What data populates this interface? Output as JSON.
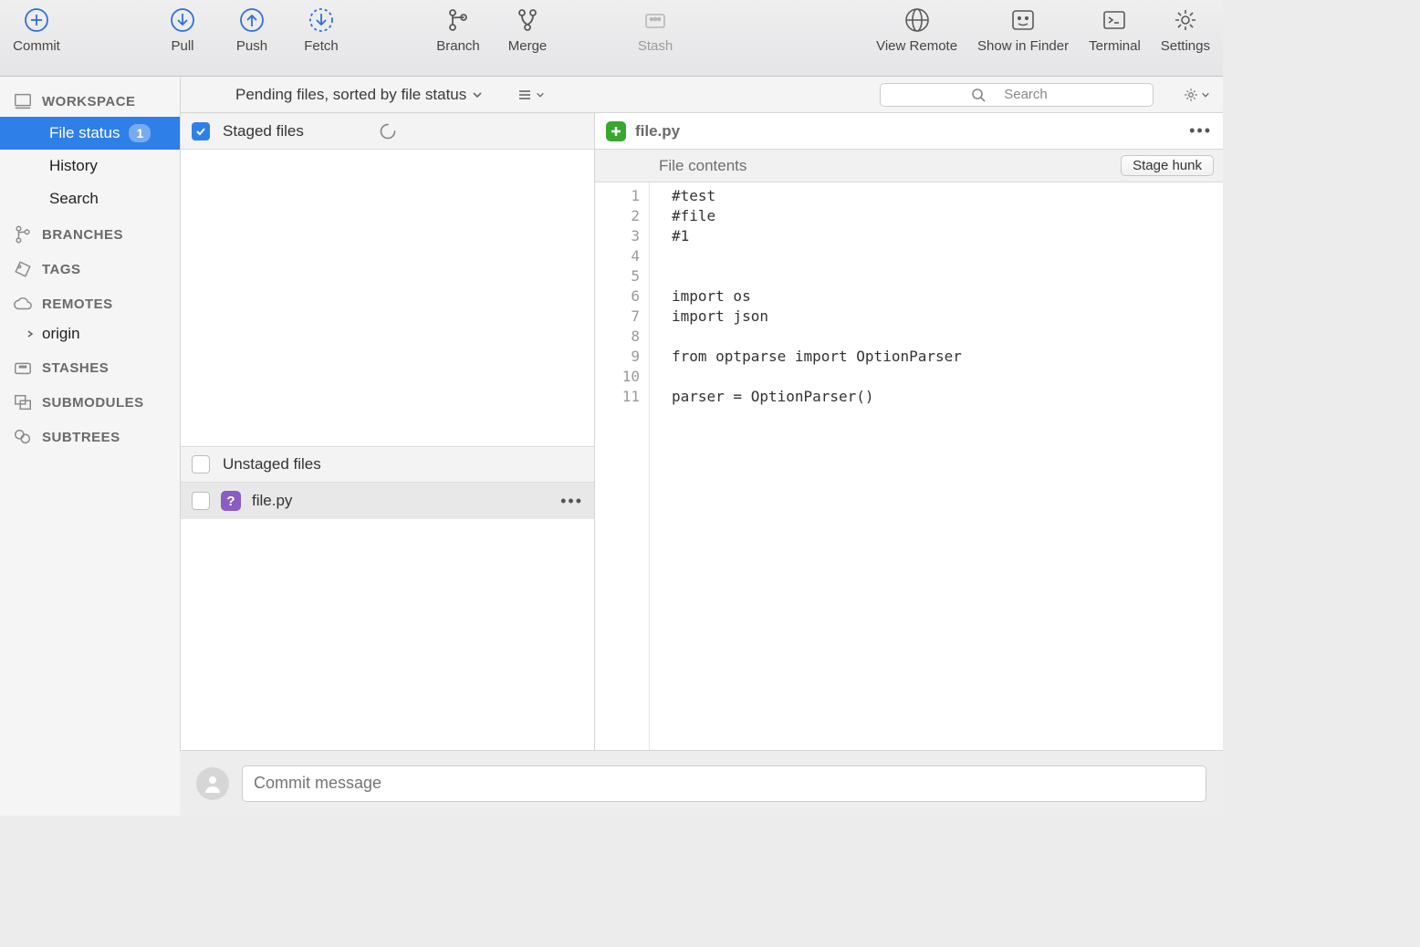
{
  "toolbar": {
    "commit": "Commit",
    "pull": "Pull",
    "push": "Push",
    "fetch": "Fetch",
    "branch": "Branch",
    "merge": "Merge",
    "stash": "Stash",
    "view_remote": "View Remote",
    "show_in_finder": "Show in Finder",
    "terminal": "Terminal",
    "settings": "Settings"
  },
  "sidebar": {
    "workspace_hdr": "WORKSPACE",
    "items": {
      "file_status": "File status",
      "file_status_badge": "1",
      "history": "History",
      "search": "Search"
    },
    "branches_hdr": "BRANCHES",
    "tags_hdr": "TAGS",
    "remotes_hdr": "REMOTES",
    "remotes": {
      "origin": "origin"
    },
    "stashes_hdr": "STASHES",
    "submodules_hdr": "SUBMODULES",
    "subtrees_hdr": "SUBTREES"
  },
  "center": {
    "pending_label": "Pending files, sorted by file status",
    "search_placeholder": "Search",
    "staged_hdr": "Staged files",
    "unstaged_hdr": "Unstaged files",
    "unstaged_file": "file.py"
  },
  "diff": {
    "file_name": "file.py",
    "file_contents_label": "File contents",
    "stage_hunk": "Stage hunk",
    "line_numbers": [
      "1",
      "2",
      "3",
      "4",
      "5",
      "6",
      "7",
      "8",
      "9",
      "10",
      "11"
    ],
    "lines": [
      "#test",
      "#file",
      "#1",
      "",
      "",
      "import os",
      "import json",
      "",
      "from optparse import OptionParser",
      "",
      "parser = OptionParser()"
    ]
  },
  "commit": {
    "placeholder": "Commit message"
  }
}
